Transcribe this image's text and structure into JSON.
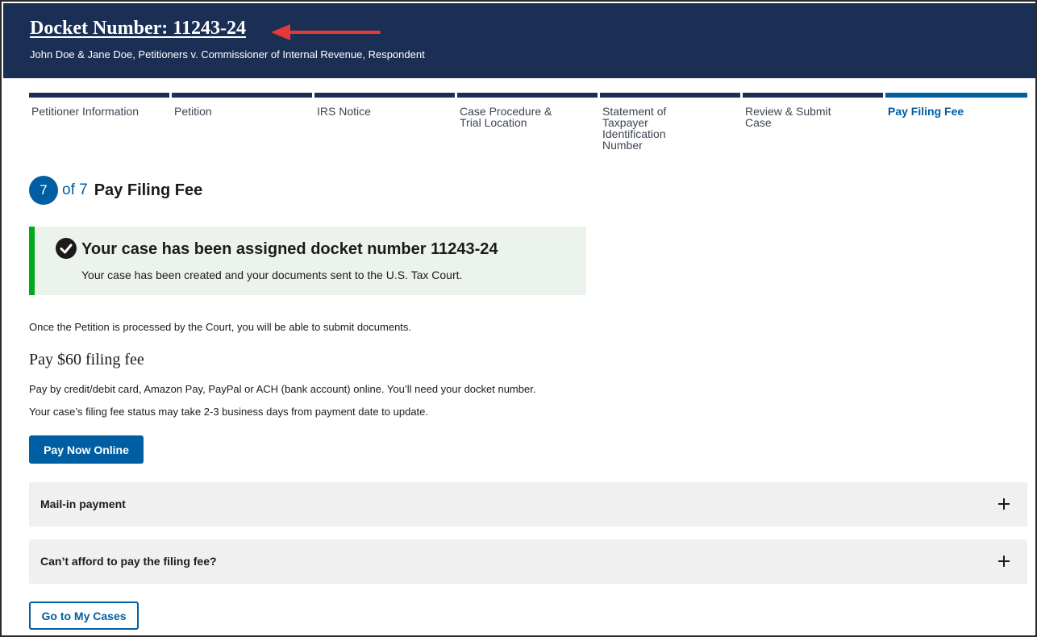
{
  "header": {
    "docket_title": "Docket Number: 11243-24",
    "caption": "John Doe & Jane Doe, Petitioners v. Commissioner of Internal Revenue, Respondent"
  },
  "stepper": {
    "steps": [
      {
        "label": "Petitioner Information"
      },
      {
        "label": "Petition"
      },
      {
        "label": "IRS Notice"
      },
      {
        "label": "Case Procedure & Trial Location"
      },
      {
        "label": "Statement of Taxpayer Identification Number"
      },
      {
        "label": "Review & Submit Case"
      },
      {
        "label": "Pay Filing Fee"
      }
    ],
    "current_step": "7",
    "total_label": "of 7",
    "current_title": "Pay Filing Fee"
  },
  "alert": {
    "heading": "Your case has been assigned docket number 11243-24",
    "text": "Your case has been created and your documents sent to the U.S. Tax Court."
  },
  "main": {
    "info": "Once the Petition is processed by the Court, you will be able to submit documents.",
    "fee_title": "Pay $60 filing fee",
    "fee_text1": "Pay by credit/debit card, Amazon Pay, PayPal or ACH (bank account) online. You’ll need your docket number.",
    "fee_text2": "Your case’s filing fee status may take 2-3 business days from payment date to update.",
    "pay_button": "Pay Now Online",
    "accordions": [
      {
        "label": "Mail-in payment"
      },
      {
        "label": "Can’t afford to pay the filing fee?"
      }
    ],
    "my_cases_button": "Go to My Cases"
  },
  "colors": {
    "header_bg": "#1b2f54",
    "primary": "#005ea2",
    "success": "#00a91c",
    "alert_bg": "#ecf3ec",
    "accordion_bg": "#f0f0f0",
    "annotation_arrow": "#e53935"
  }
}
